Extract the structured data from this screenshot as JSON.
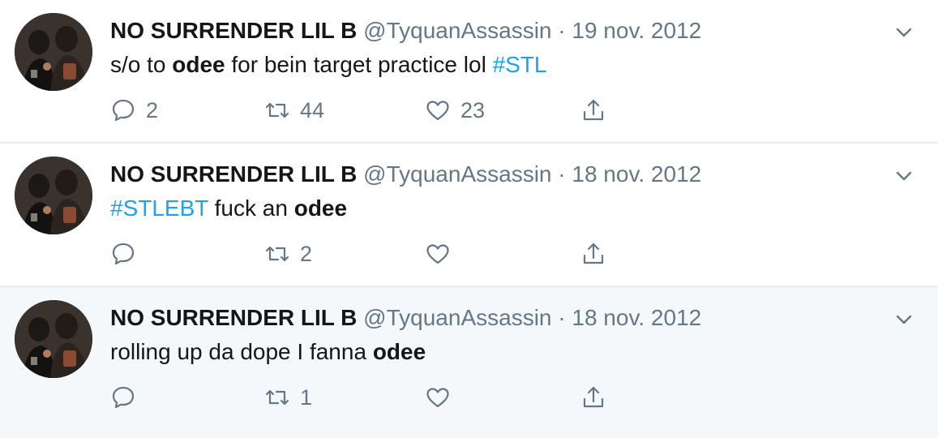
{
  "tweets": [
    {
      "name": "NO SURRENDER LIL B",
      "handle": "@TyquanAssassin",
      "separator": "·",
      "date": "19 nov. 2012",
      "text_parts": [
        {
          "t": "s/o to ",
          "k": "plain"
        },
        {
          "t": "odee",
          "k": "bold"
        },
        {
          "t": " for bein target practice lol ",
          "k": "plain"
        },
        {
          "t": "#STL",
          "k": "tag"
        }
      ],
      "reply_count": "2",
      "retweet_count": "44",
      "like_count": "23"
    },
    {
      "name": "NO SURRENDER LIL B",
      "handle": "@TyquanAssassin",
      "separator": "·",
      "date": "18 nov. 2012",
      "text_parts": [
        {
          "t": "#STLEBT",
          "k": "tag"
        },
        {
          "t": " fuck an ",
          "k": "plain"
        },
        {
          "t": "odee",
          "k": "bold"
        }
      ],
      "reply_count": "",
      "retweet_count": "2",
      "like_count": ""
    },
    {
      "name": "NO SURRENDER LIL B",
      "handle": "@TyquanAssassin",
      "separator": "·",
      "date": "18 nov. 2012",
      "text_parts": [
        {
          "t": "rolling up da dope I fanna ",
          "k": "plain"
        },
        {
          "t": "odee",
          "k": "bold"
        }
      ],
      "reply_count": "",
      "retweet_count": "1",
      "like_count": ""
    }
  ],
  "icons": {
    "reply": "reply-icon",
    "retweet": "retweet-icon",
    "like": "like-icon",
    "share": "share-icon",
    "caret": "chevron-down-icon"
  },
  "colors": {
    "name": "#14171a",
    "meta": "#657786",
    "hashtag": "#1da1f2",
    "hover_bg": "#f5f8fa",
    "divider": "#e6ecf0"
  }
}
